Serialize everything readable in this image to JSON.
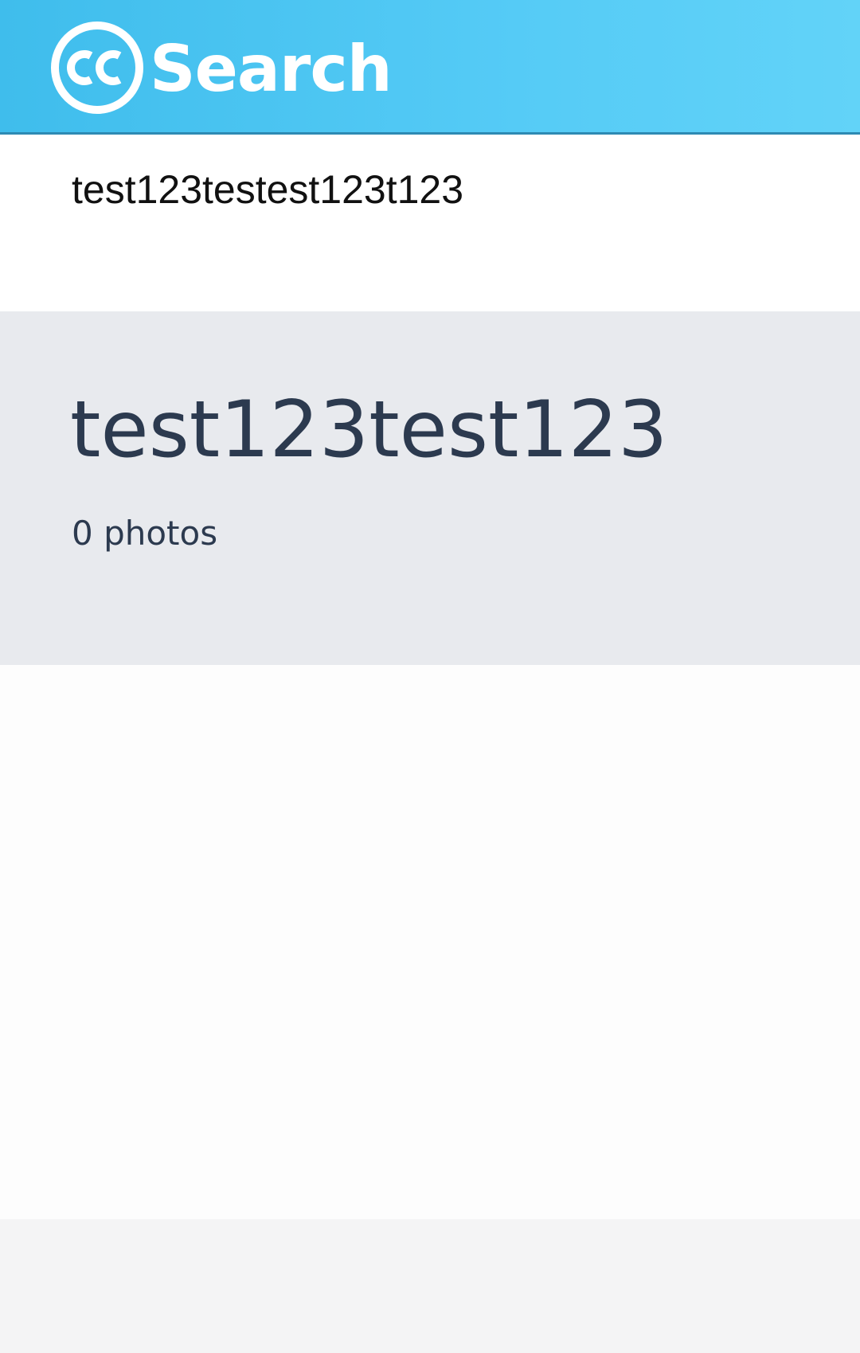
{
  "header": {
    "logo_icon": "creative-commons-cc-icon",
    "logo_text": "Search",
    "background_color": "#4ec5f2"
  },
  "search": {
    "value": "test123testest123t123"
  },
  "collection": {
    "title": "test123test123",
    "count_label": "0 photos"
  },
  "colors": {
    "title_text": "#2c3a4f",
    "collection_bg": "#e8eaee"
  }
}
